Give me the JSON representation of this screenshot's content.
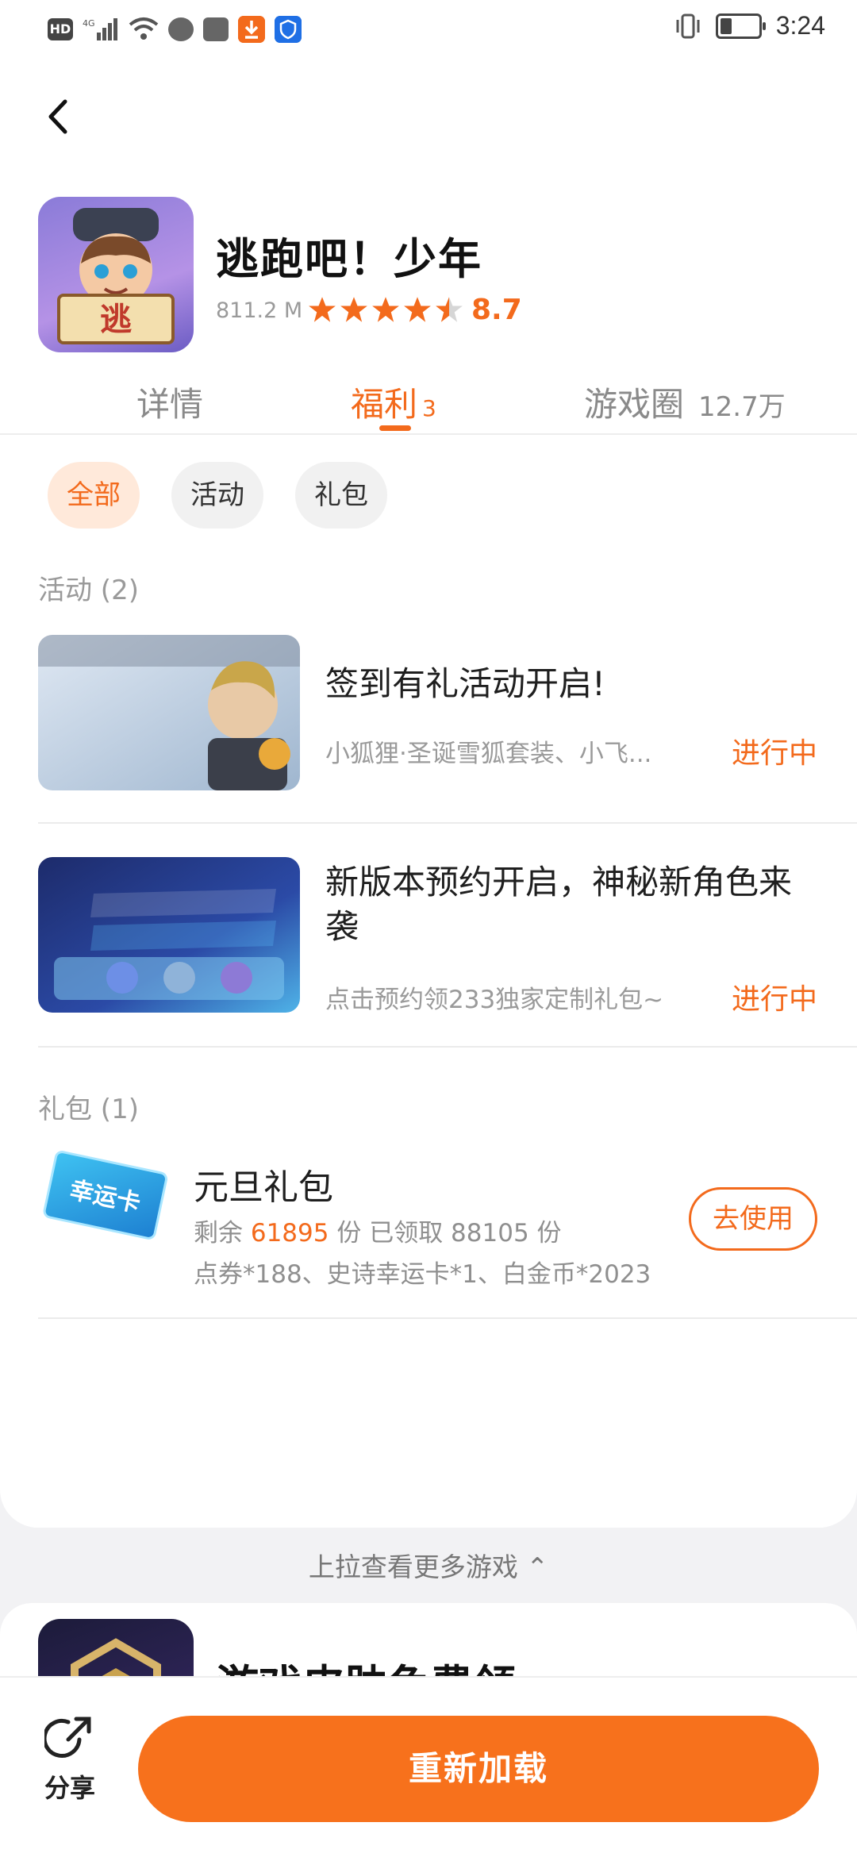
{
  "status_bar": {
    "left_icons": [
      "hd-icon",
      "signal-4g-icon",
      "wifi-icon",
      "message-icon",
      "huawei-icon",
      "download-icon",
      "shield-icon"
    ],
    "hd_label": "HD",
    "battery_level": 0.3,
    "time": "3:24"
  },
  "header": {
    "back_icon": "back-arrow-icon"
  },
  "game": {
    "title": "逃跑吧！少年",
    "size": "811.2 M",
    "rating": "8.7",
    "stars": 4.5
  },
  "tabs": [
    {
      "label": "详情",
      "extra": ""
    },
    {
      "label": "福利",
      "extra": "3"
    },
    {
      "label": "游戏圈",
      "extra": "12.7万"
    }
  ],
  "filters": [
    "全部",
    "活动",
    "礼包"
  ],
  "activities": {
    "section_label": "活动 (2)",
    "items": [
      {
        "title": "签到有礼活动开启!",
        "subtitle": "小狐狸·圣诞雪狐套装、小飞...",
        "status": "进行中"
      },
      {
        "title": "新版本预约开启，神秘新角色来袭",
        "subtitle": "点击预约领233独家定制礼包~",
        "status": "进行中"
      }
    ]
  },
  "gifts": {
    "section_label": "礼包 (1)",
    "items": [
      {
        "thumb_text": "幸运卡",
        "title": "元旦礼包",
        "remain_prefix": "剩余 ",
        "remain": "61895",
        "remain_suffix": " 份 已领取 88105 份",
        "contents": "点券*188、史诗幸运卡*1、白金币*2023",
        "action": "去使用"
      }
    ]
  },
  "pull_hint": "上拉查看更多游戏 ⌃",
  "next_game": {
    "title": "游戏皮肤免费领"
  },
  "bottom": {
    "share_label": "分享",
    "reload_label": "重新加载"
  },
  "colors": {
    "accent": "#f36a1c",
    "chip_active_bg": "#ffe9da",
    "muted": "#9a9a9a"
  }
}
